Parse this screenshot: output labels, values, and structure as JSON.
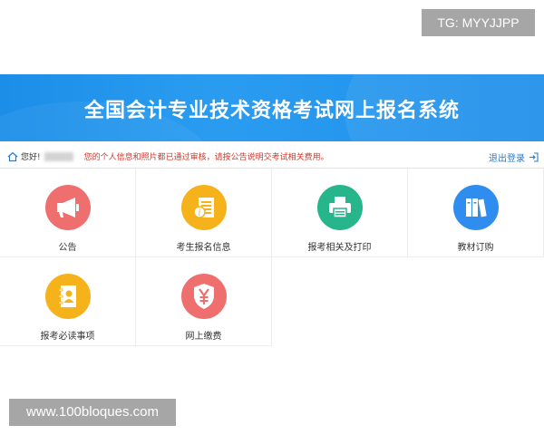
{
  "watermarks": {
    "top_right": "TG: MYYJJPP",
    "bottom_left": "www.100bloques.com"
  },
  "banner": {
    "title": "全国会计专业技术资格考试网上报名系统"
  },
  "userbar": {
    "greeting": "您好!",
    "notice": "您的个人信息和照片都已通过审核，请按公告说明交考试相关费用。",
    "logout_label": "退出登录"
  },
  "menu": [
    {
      "label": "公告",
      "icon": "megaphone-icon",
      "color": "#ef6f6f"
    },
    {
      "label": "考生报名信息",
      "icon": "document-info-icon",
      "color": "#f5b21a"
    },
    {
      "label": "报考相关及打印",
      "icon": "printer-icon",
      "color": "#27b58c"
    },
    {
      "label": "教材订购",
      "icon": "books-icon",
      "color": "#2f8df0"
    },
    {
      "label": "报考必读事项",
      "icon": "notebook-contact-icon",
      "color": "#f5b21a"
    },
    {
      "label": "网上缴费",
      "icon": "yuan-shield-icon",
      "color": "#ef6f6f"
    }
  ],
  "colors": {
    "banner": "#1c8ee8",
    "link": "#1f7ed8",
    "notice": "#d33a2c"
  }
}
